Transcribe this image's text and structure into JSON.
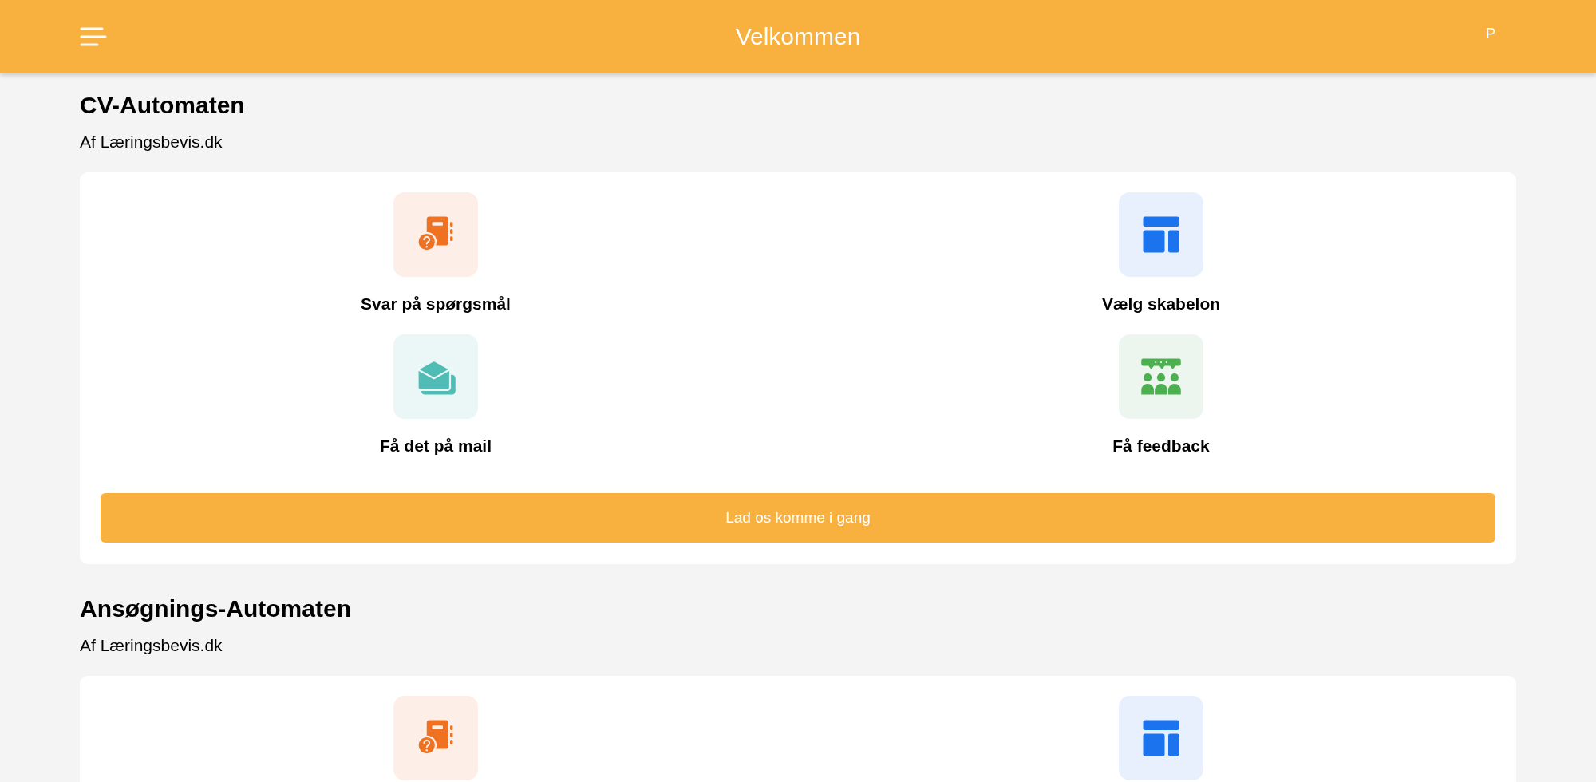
{
  "header": {
    "title": "Velkommen",
    "avatar": "P"
  },
  "sections": [
    {
      "title": "CV-Automaten",
      "author": "Af Læringsbevis.dk",
      "features": [
        {
          "kind": "questions",
          "label": "Svar på spørgsmål"
        },
        {
          "kind": "template",
          "label": "Vælg skabelon"
        },
        {
          "kind": "mail",
          "label": "Få det på mail"
        },
        {
          "kind": "feedback",
          "label": "Få feedback"
        }
      ],
      "button": "Lad os komme i gang"
    },
    {
      "title": "Ansøgnings-Automaten",
      "author": "Af Læringsbevis.dk",
      "features": [
        {
          "kind": "questions"
        },
        {
          "kind": "template"
        }
      ]
    }
  ]
}
